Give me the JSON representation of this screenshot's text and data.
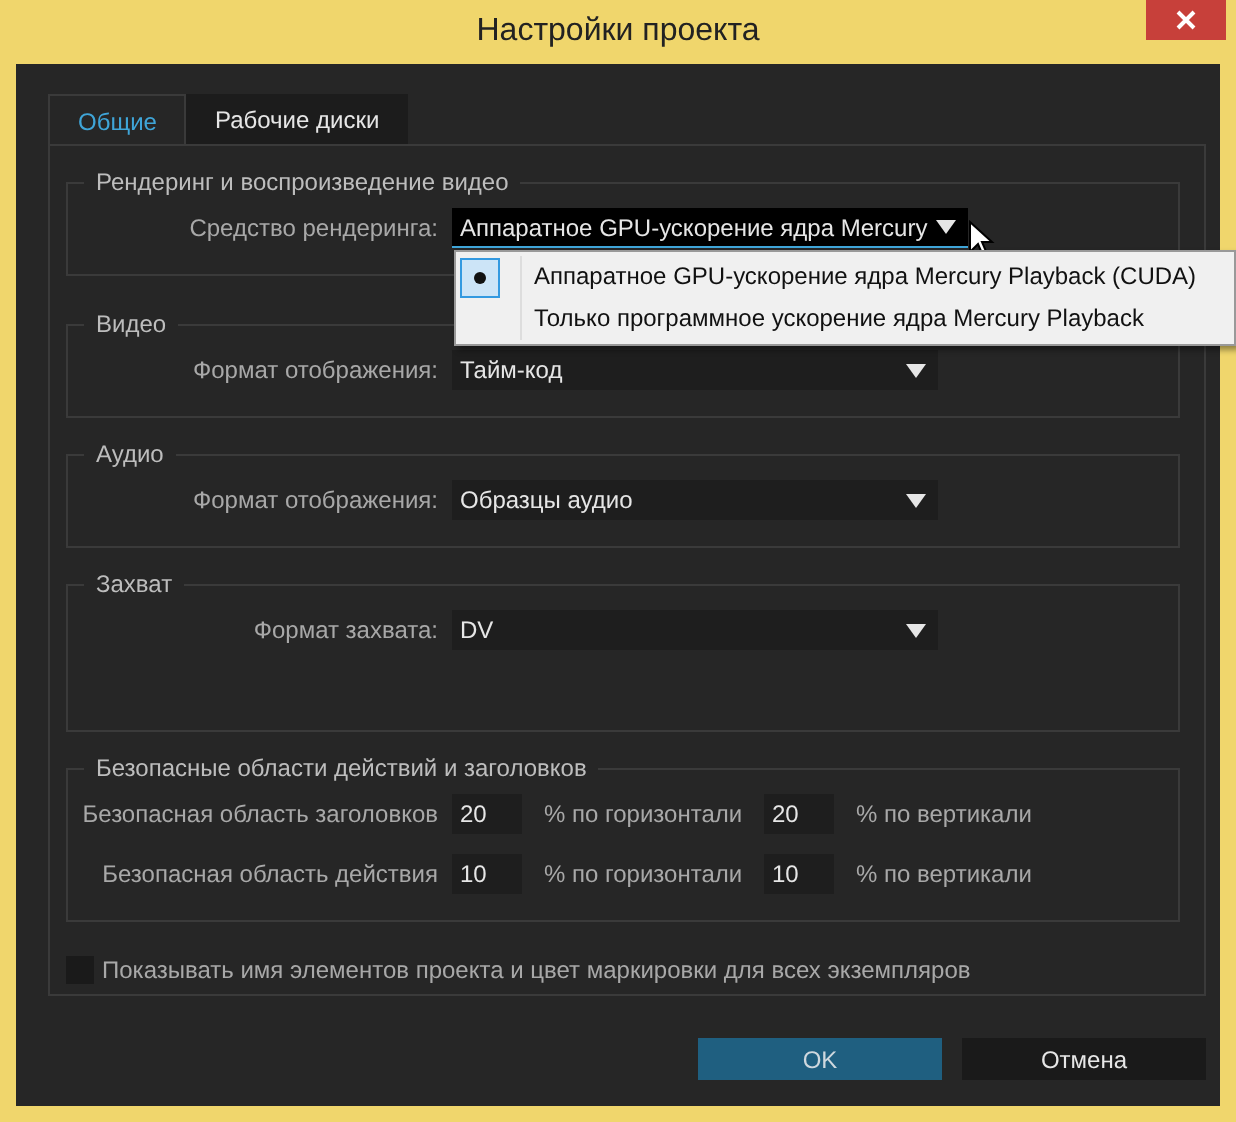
{
  "window": {
    "title": "Настройки проекта"
  },
  "tabs": [
    {
      "label": "Общие",
      "selected": true
    },
    {
      "label": "Рабочие диски",
      "selected": false
    }
  ],
  "groups": [
    {
      "title": "Рендеринг и воспроизведение видео",
      "kind": "select",
      "fields": [
        {
          "label": "Средство рендеринга:",
          "value": "Аппаратное GPU-ускорение ядра Mercury",
          "open": true
        }
      ]
    },
    {
      "title": "Видео",
      "kind": "select",
      "fields": [
        {
          "label": "Формат отображения:",
          "value": "Тайм-код",
          "open": false
        }
      ]
    },
    {
      "title": "Аудио",
      "kind": "select",
      "fields": [
        {
          "label": "Формат отображения:",
          "value": "Образцы аудио",
          "open": false
        }
      ]
    },
    {
      "title": "Захват",
      "kind": "select",
      "fields": [
        {
          "label": "Формат захвата:",
          "value": "DV",
          "open": false
        }
      ]
    },
    {
      "title": "Безопасные области действий и заголовков",
      "kind": "safe",
      "fields": [
        {
          "label": "Безопасная область заголовков",
          "horizontal": "20",
          "horizontal_unit": "% по горизонтали",
          "vertical": "20",
          "vertical_unit": "% по вертикали"
        },
        {
          "label": "Безопасная область действия",
          "horizontal": "10",
          "horizontal_unit": "% по горизонтали",
          "vertical": "10",
          "vertical_unit": "% по вертикали"
        }
      ]
    }
  ],
  "dropdown_menu": {
    "items": [
      {
        "label": "Аппаратное GPU-ускорение ядра Mercury Playback (CUDA)",
        "selected": true
      },
      {
        "label": "Только программное ускорение ядра Mercury Playback",
        "selected": false
      }
    ]
  },
  "checkbox": {
    "label": "Показывать имя элементов проекта и цвет маркировки для всех экземпляров",
    "checked": false
  },
  "buttons": [
    {
      "label": "OK",
      "primary": true
    },
    {
      "label": "Отмена",
      "primary": false
    }
  ]
}
